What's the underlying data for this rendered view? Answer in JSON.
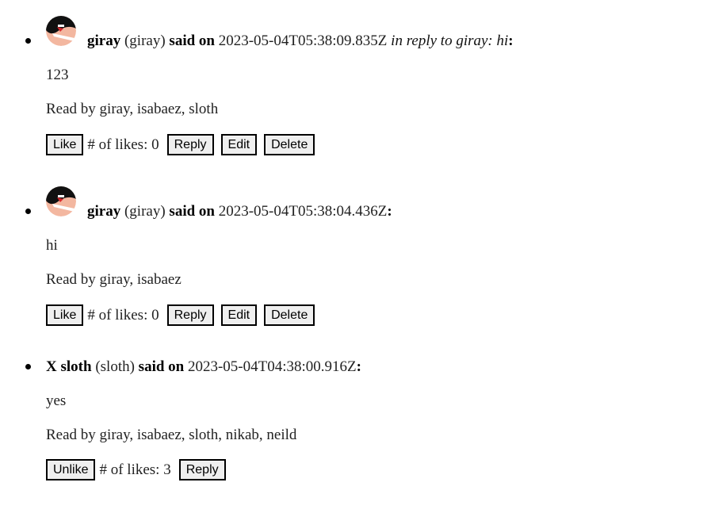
{
  "messages": [
    {
      "avatar": "avatar-image",
      "display_name": "giray",
      "username": "(giray)",
      "said_on": "said on",
      "timestamp": "2023-05-04T05:38:09.835Z",
      "reply_note": "in reply to giray: hi",
      "colon": ":",
      "body": "123",
      "read_by": "Read by giray, isabaez, sloth",
      "like_label": "Like",
      "likes_text": "# of likes: 0",
      "reply_label": "Reply",
      "edit_label": "Edit",
      "delete_label": "Delete"
    },
    {
      "avatar": "avatar-image",
      "display_name": "giray",
      "username": "(giray)",
      "said_on": "said on",
      "timestamp": "2023-05-04T05:38:04.436Z",
      "colon": ":",
      "body": "hi",
      "read_by": "Read by giray, isabaez",
      "like_label": "Like",
      "likes_text": "# of likes: 0",
      "reply_label": "Reply",
      "edit_label": "Edit",
      "delete_label": "Delete"
    },
    {
      "avatar_alt": "X",
      "display_name": "sloth",
      "username": "(sloth)",
      "said_on": "said on",
      "timestamp": "2023-05-04T04:38:00.916Z",
      "colon": ":",
      "body": "yes",
      "read_by": "Read by giray, isabaez, sloth, nikab, neild",
      "like_label": "Unlike",
      "likes_text": "# of likes: 3",
      "reply_label": "Reply"
    }
  ]
}
